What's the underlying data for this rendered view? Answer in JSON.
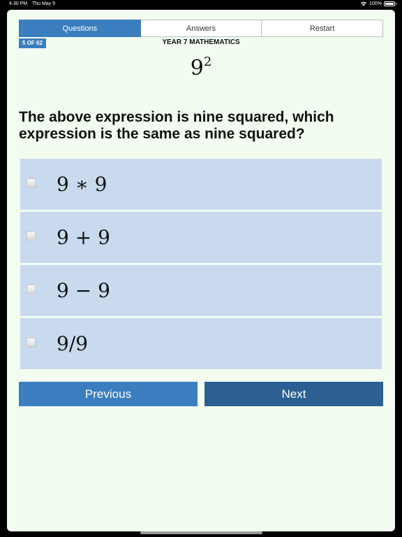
{
  "status": {
    "time": "4:30 PM",
    "date": "Thu May 9",
    "battery": "100%"
  },
  "tabs": [
    {
      "label": "Questions",
      "active": true
    },
    {
      "label": "Answers",
      "active": false
    },
    {
      "label": "Restart",
      "active": false
    }
  ],
  "progress": {
    "counter": "5 OF 62",
    "current": 5,
    "total": 62
  },
  "subject": "YEAR 7 MATHEMATICS",
  "expression": {
    "base": "9",
    "exponent": "2"
  },
  "question": "The above expression is nine squared, which expression is the same as nine squared?",
  "answers": [
    {
      "text": "9 ∗ 9",
      "checked": false
    },
    {
      "text": "9 + 9",
      "checked": false
    },
    {
      "text": "9 − 9",
      "checked": false
    },
    {
      "text": "9/9",
      "checked": false
    }
  ],
  "navigation": {
    "previous_label": "Previous",
    "next_label": "Next"
  },
  "colors": {
    "accent": "#3a7ebf",
    "accent_dark": "#2b5f91",
    "answer_bg": "#c9daee",
    "page_bg": "#f3fcf1"
  }
}
